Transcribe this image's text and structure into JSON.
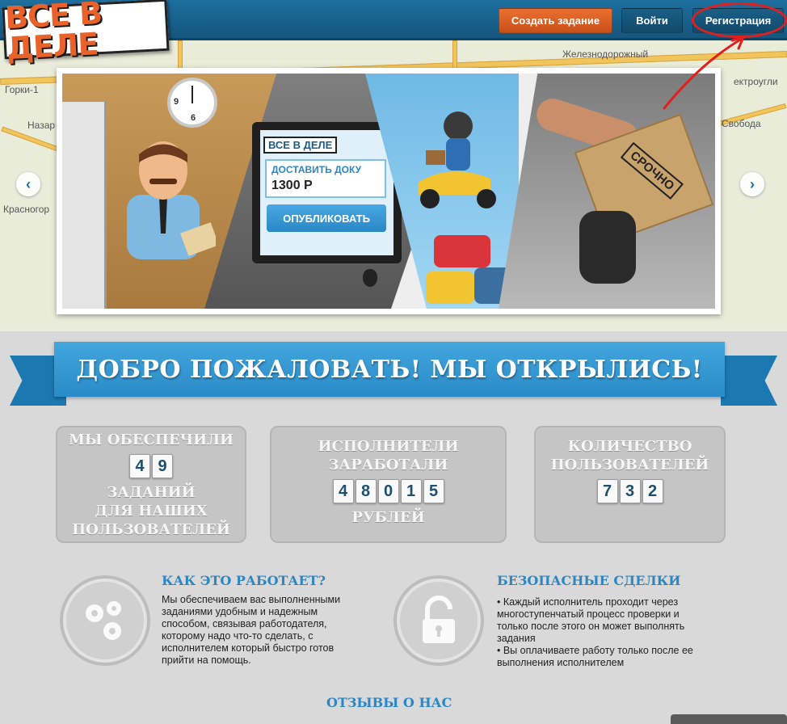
{
  "header": {
    "logo_text": "ВСЕ В ДЕЛЕ",
    "buttons": {
      "create_task": "Создать задание",
      "login": "Войти",
      "register": "Регистрация"
    }
  },
  "map": {
    "labels": [
      "Железнодорожный",
      "Горки-1",
      "Назар",
      "ектроугли",
      "Свобода",
      "Красногор"
    ]
  },
  "banner": {
    "screen_logo": "ВСЕ В ДЕЛЕ",
    "task_text": "ДОСТАВИТЬ ДОКУ",
    "task_price": "1300 Р",
    "publish_button": "ОПУБЛИКОВАТЬ",
    "envelope_stamp": "СРОЧНО",
    "clock_numbers": [
      "9",
      "6"
    ]
  },
  "welcome": {
    "title": "ДОБРО ПОЖАЛОВАТЬ! МЫ ОТКРЫЛИСЬ!"
  },
  "stats": [
    {
      "top": "МЫ ОБЕСПЕЧИЛИ",
      "digits": [
        "4",
        "9"
      ],
      "bottom_lines": [
        "ЗАДАНИЙ",
        "ДЛЯ НАШИХ",
        "ПОЛЬЗОВАТЕЛЕЙ"
      ]
    },
    {
      "top_lines": [
        "ИСПОЛНИТЕЛИ",
        "ЗАРАБОТАЛИ"
      ],
      "digits": [
        "4",
        "8",
        "0",
        "1",
        "5"
      ],
      "bottom": "РУБЛЕЙ"
    },
    {
      "top_lines": [
        "КОЛИЧЕСТВО",
        "ПОЛЬЗОВАТЕЛЕЙ"
      ],
      "digits": [
        "7",
        "3",
        "2"
      ]
    }
  ],
  "features": [
    {
      "title": "КАК ЭТО РАБОТАЕТ?",
      "icon": "gears-icon",
      "text": "Мы обеспечиваем вас выполненными заданиями удобным и надежным способом, связывая работодателя, которому надо что-то сделать, с исполнителем который быстро готов прийти на помощь."
    },
    {
      "title": "БЕЗОПАСНЫЕ СДЕЛКИ",
      "icon": "padlock-icon",
      "text_lines": [
        "• Каждый исполнитель проходит через многоступенчатый процесс проверки и только после этого он может выполнять задания",
        "• Вы оплачиваете работу только после ее выполнения исполнителем"
      ]
    }
  ],
  "reviews": {
    "title": "ОТЗЫВЫ О НАС"
  },
  "colors": {
    "accent_blue": "#2a87c4",
    "orange": "#e8622a",
    "annotation_red": "#e0201c"
  }
}
